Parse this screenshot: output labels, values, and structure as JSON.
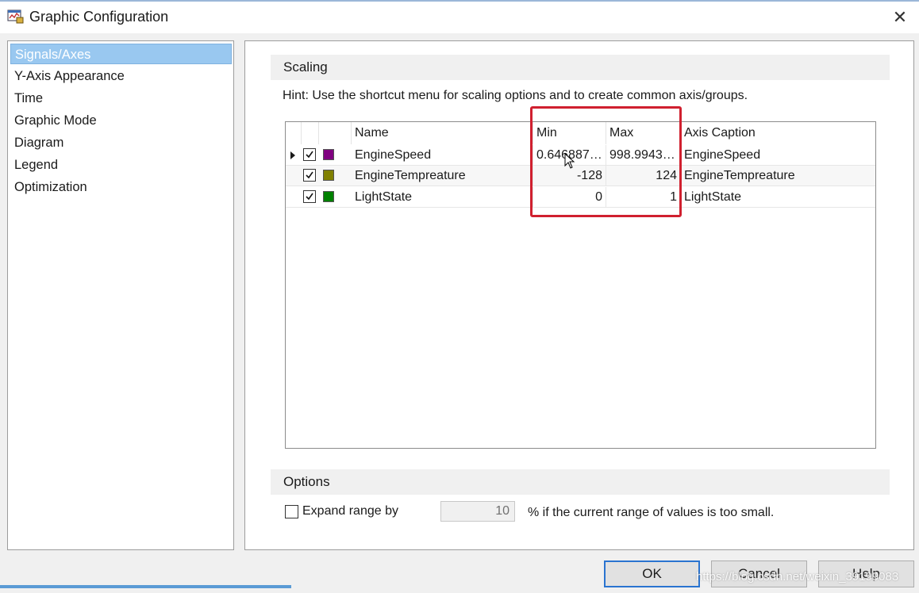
{
  "window": {
    "title": "Graphic Configuration"
  },
  "nav": {
    "items": [
      {
        "label": "Signals/Axes",
        "selected": true
      },
      {
        "label": "Y-Axis Appearance"
      },
      {
        "label": "Time"
      },
      {
        "label": "Graphic Mode"
      },
      {
        "label": "Diagram"
      },
      {
        "label": "Legend"
      },
      {
        "label": "Optimization"
      }
    ]
  },
  "scaling": {
    "header": "Scaling",
    "hint": "Hint: Use the shortcut menu for scaling options and to create common axis/groups.",
    "columns": {
      "name": "Name",
      "min": "Min",
      "max": "Max",
      "caption": "Axis Caption"
    },
    "rows": [
      {
        "name": "EngineSpeed",
        "min": "0.646887…",
        "max": "998.9943…",
        "caption": "EngineSpeed",
        "color": "#800080",
        "checked": true,
        "current": true
      },
      {
        "name": "EngineTempreature",
        "min": "-128",
        "max": "124",
        "caption": "EngineTempreature",
        "color": "#808000",
        "checked": true
      },
      {
        "name": "LightState",
        "min": "0",
        "max": "1",
        "caption": "LightState",
        "color": "#008000",
        "checked": true
      }
    ]
  },
  "options": {
    "header": "Options",
    "expand_label": "Expand range by",
    "expand_value": "10",
    "expand_suffix": "%  if the current range of values is too small.",
    "expand_checked": false
  },
  "buttons": {
    "ok": "OK",
    "cancel": "Cancel",
    "help": "Help"
  },
  "watermark": "https://blog.csdn.net/weixin_39199083",
  "colors": {
    "selection": "#99c8f0",
    "highlight": "#d0202f",
    "primary_border": "#2a74d0"
  }
}
